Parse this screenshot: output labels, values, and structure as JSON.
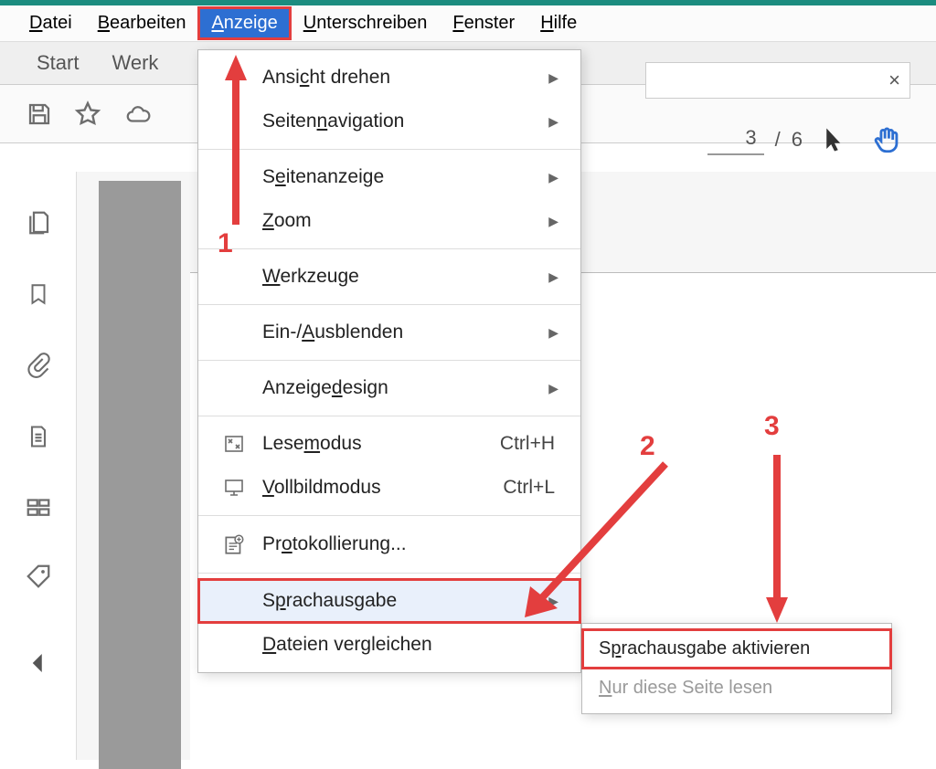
{
  "menubar": {
    "items": [
      {
        "pre": "D",
        "u": "",
        "post": "atei"
      },
      {
        "pre": "B",
        "u": "",
        "post": "earbeiten"
      },
      {
        "pre": "A",
        "u": "",
        "post": "nzeige"
      },
      {
        "pre": "U",
        "u": "",
        "post": "nterschreiben"
      },
      {
        "pre": "F",
        "u": "",
        "post": "enster"
      },
      {
        "pre": "H",
        "u": "",
        "post": "ilfe"
      }
    ]
  },
  "tabs": {
    "start": "Start",
    "tools": "Werk"
  },
  "search": {
    "close": "×"
  },
  "page": {
    "current": "3",
    "total": "6",
    "sep": "/"
  },
  "dropdown": {
    "items": [
      {
        "label_pre": "Ansi",
        "label_u": "c",
        "label_post": "ht drehen",
        "arrow": true
      },
      {
        "label_pre": "Seiten",
        "label_u": "n",
        "label_post": "avigation",
        "arrow": true
      },
      {
        "sep": true
      },
      {
        "label_pre": "S",
        "label_u": "e",
        "label_post": "itenanzeige",
        "arrow": true
      },
      {
        "label_pre": "",
        "label_u": "Z",
        "label_post": "oom",
        "arrow": true
      },
      {
        "sep": true
      },
      {
        "label_pre": "",
        "label_u": "W",
        "label_post": "erkzeuge",
        "arrow": true
      },
      {
        "sep": true
      },
      {
        "label_pre": "Ein-/",
        "label_u": "A",
        "label_post": "usblenden",
        "arrow": true
      },
      {
        "sep": true
      },
      {
        "label_pre": "Anzeige",
        "label_u": "d",
        "label_post": "esign",
        "arrow": true
      },
      {
        "sep": true
      },
      {
        "icon": "read",
        "label_pre": "Lese",
        "label_u": "m",
        "label_post": "odus",
        "shortcut": "Ctrl+H"
      },
      {
        "icon": "screen",
        "label_pre": "",
        "label_u": "V",
        "label_post": "ollbildmodus",
        "shortcut": "Ctrl+L"
      },
      {
        "sep": true
      },
      {
        "icon": "log",
        "label_pre": "Pr",
        "label_u": "o",
        "label_post": "tokollierung..."
      },
      {
        "sep": true
      },
      {
        "label_pre": "S",
        "label_u": "p",
        "label_post": "rachausgabe",
        "arrow": true,
        "hover": true,
        "outlined": true
      },
      {
        "label_pre": "",
        "label_u": "D",
        "label_post": "ateien vergleichen"
      }
    ]
  },
  "submenu": {
    "items": [
      {
        "label_pre": "S",
        "label_u": "p",
        "label_post": "rachausgabe aktivieren",
        "outlined": true
      },
      {
        "label_pre": "",
        "label_u": "N",
        "label_post": "ur diese Seite lesen",
        "disabled": true
      }
    ]
  },
  "annotations": {
    "n1": "1",
    "n2": "2",
    "n3": "3"
  }
}
